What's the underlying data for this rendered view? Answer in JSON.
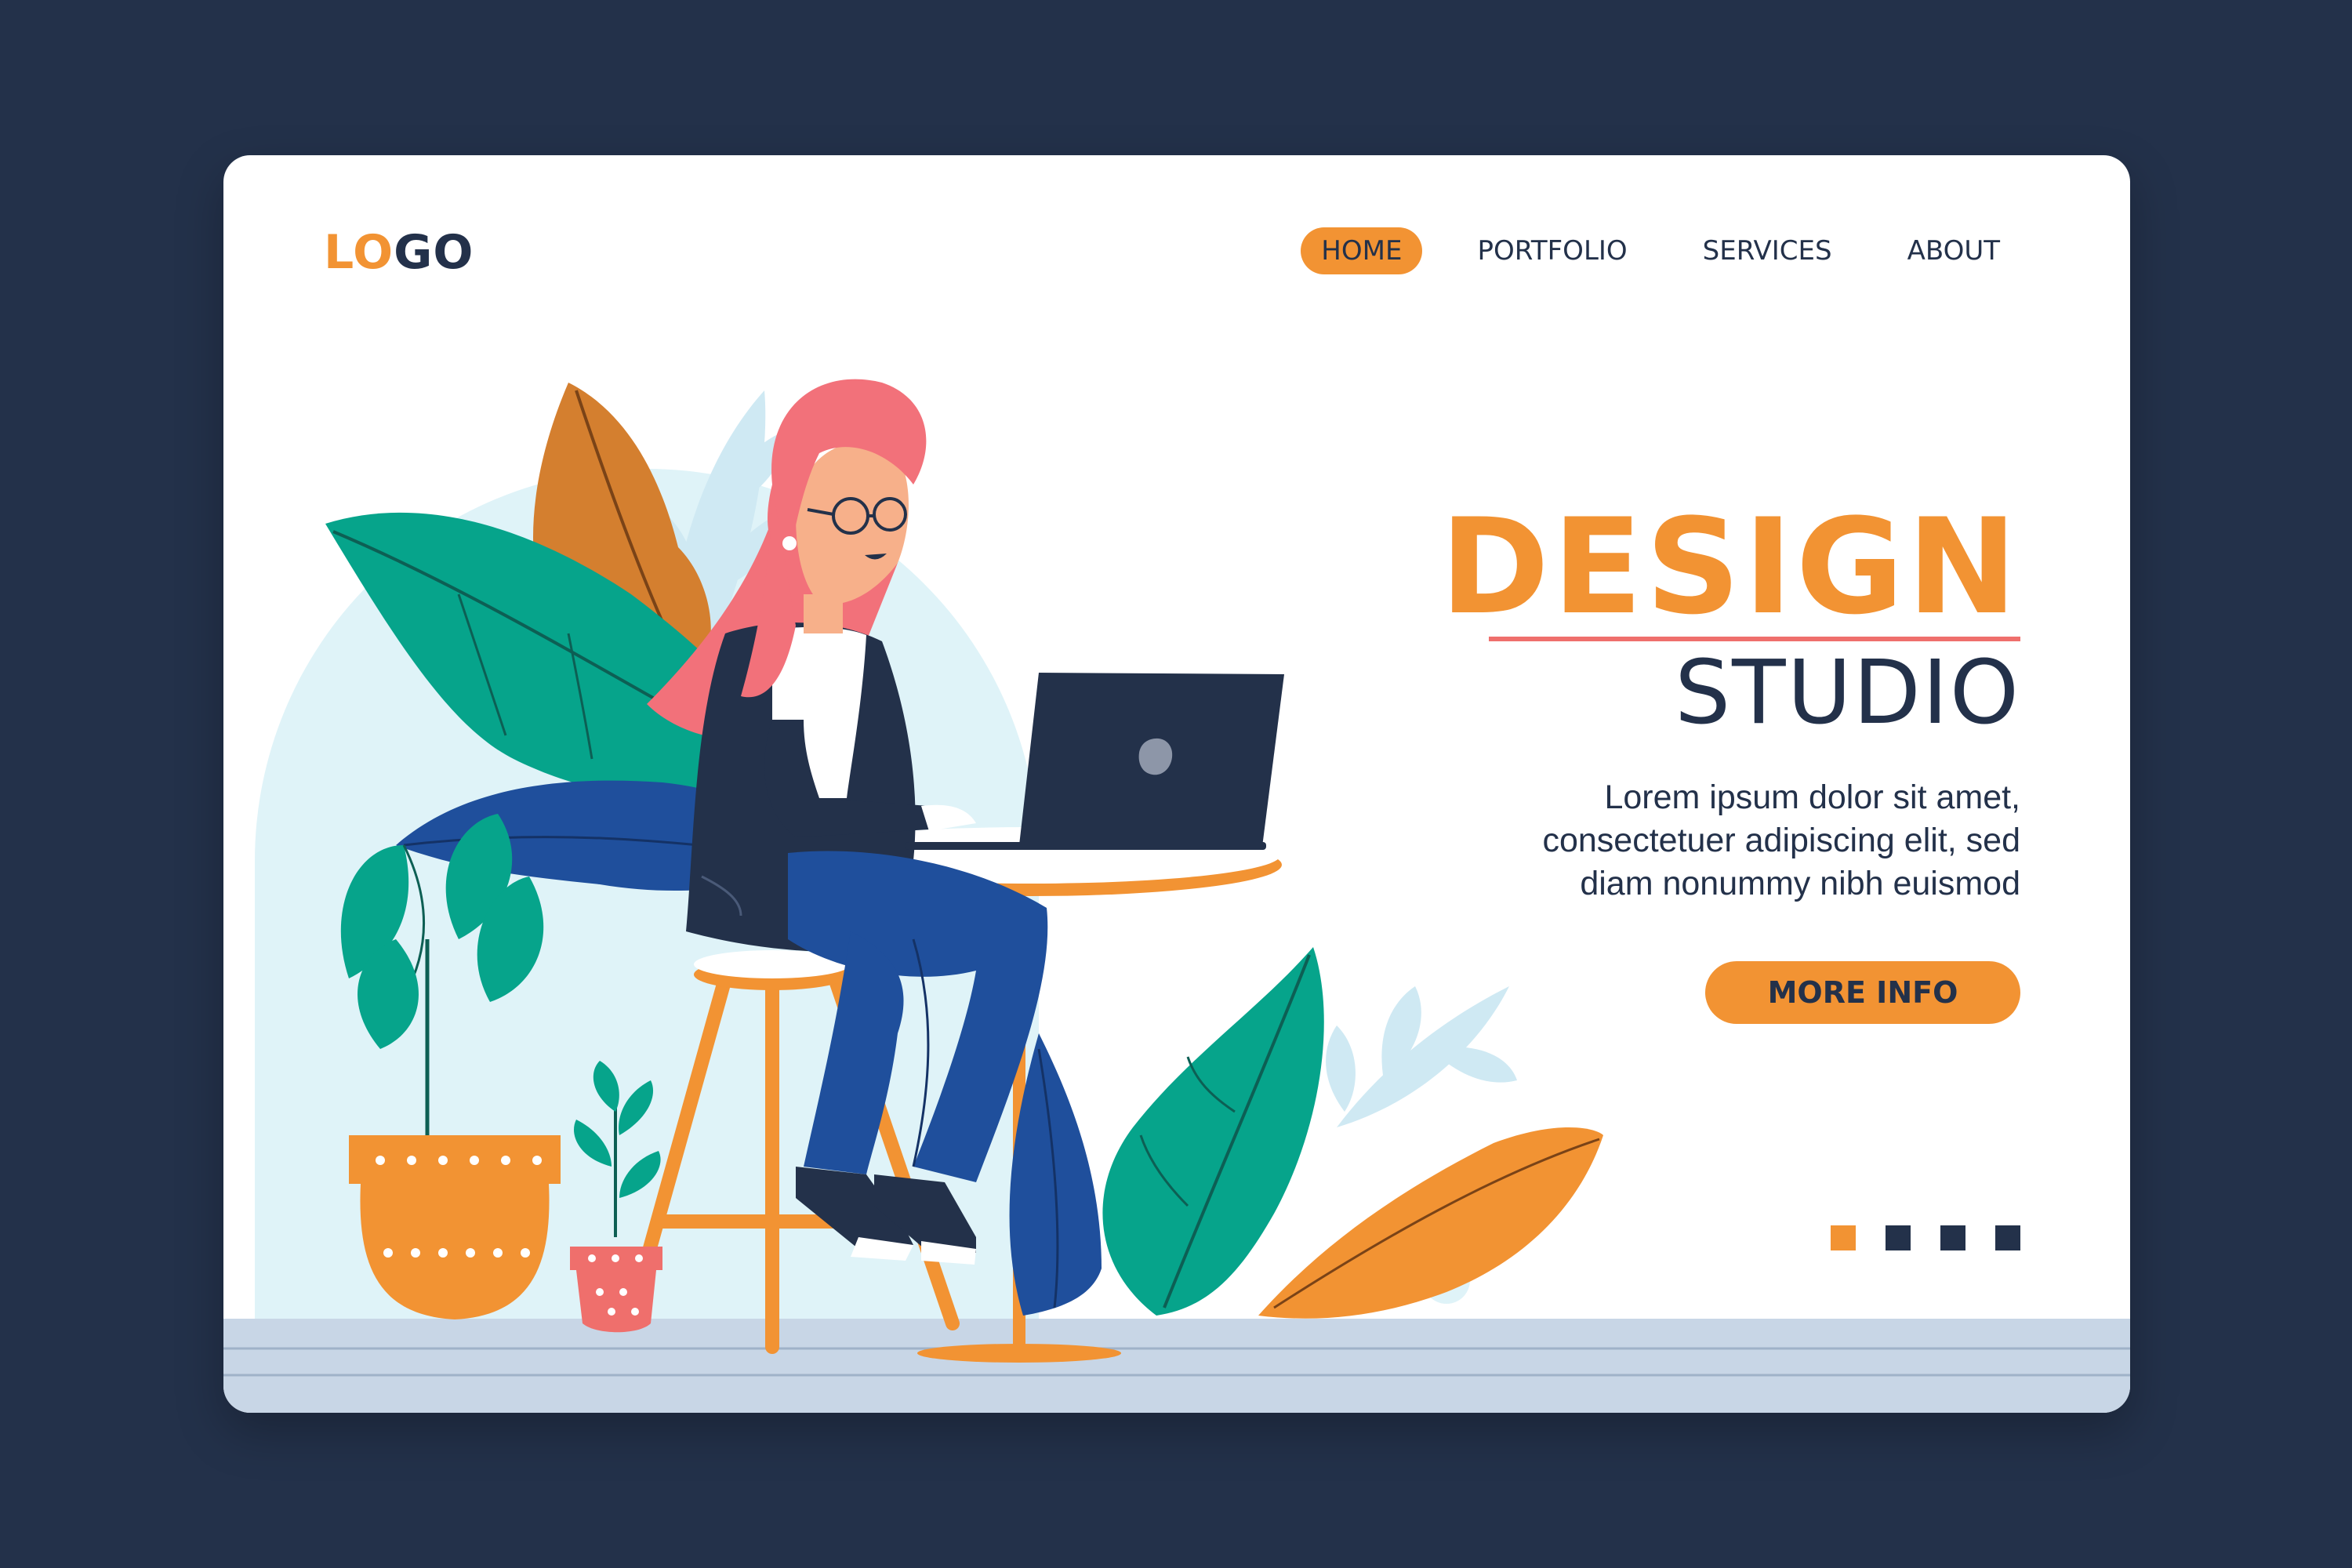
{
  "logo": {
    "part1": "LO",
    "part2": "GO"
  },
  "nav": {
    "items": [
      {
        "label": "HOME",
        "active": true
      },
      {
        "label": "PORTFOLIO",
        "active": false
      },
      {
        "label": "SERVICES",
        "active": false
      },
      {
        "label": "ABOUT",
        "active": false
      }
    ]
  },
  "hero": {
    "title": "DESIGN",
    "subtitle": "STUDIO",
    "description_lines": [
      "Lorem ipsum dolor sit amet,",
      "consectetuer adipiscing elit, sed",
      "diam nonummy nibh euismod"
    ],
    "button_label": "MORE INFO"
  },
  "pagination": {
    "count": 4,
    "active_index": 0
  },
  "colors": {
    "background": "#23314a",
    "accent": "#f29333",
    "text": "#23314a",
    "underline": "#ef6f6c",
    "leaf_green": "#06a48b",
    "leaf_blue": "#1f4f9c",
    "hair": "#f2717a",
    "light_blue": "#dff3f8"
  },
  "icons": [
    "laptop-icon",
    "apple-logo-icon"
  ]
}
